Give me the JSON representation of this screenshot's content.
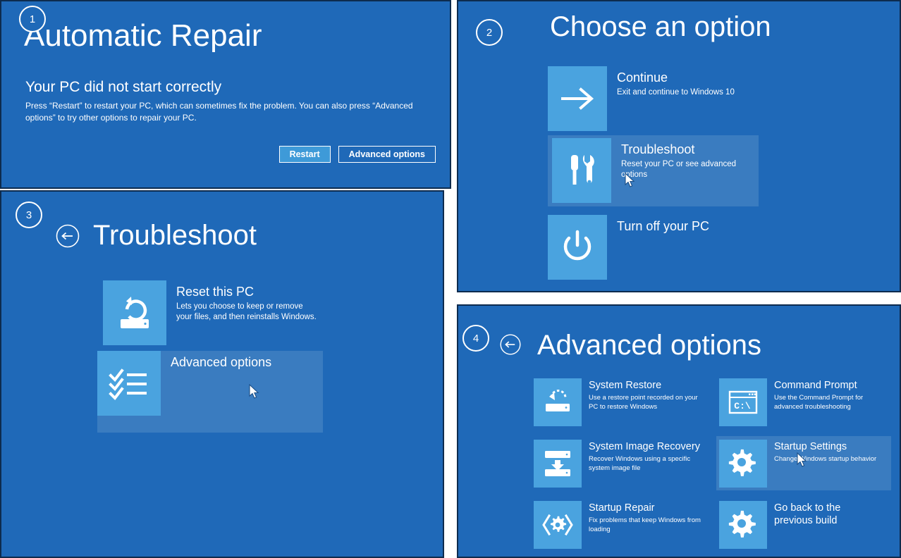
{
  "theme": {
    "background": "#1f69b8",
    "tile": "#4aa3df",
    "highlight": "#3a7cc0",
    "border": "#0d2b4e",
    "text": "#ffffff",
    "primary_button": "#3e9ad8"
  },
  "panels": [
    {
      "step": "1",
      "title": "Automatic Repair",
      "subtitle": "Your PC did not start correctly",
      "body": "Press “Restart” to restart your PC, which can sometimes fix the problem. You can also press “Advanced options” to try other options to repair your PC.",
      "buttons": [
        {
          "label": "Restart",
          "style": "primary"
        },
        {
          "label": "Advanced options",
          "style": "outline"
        }
      ]
    },
    {
      "step": "2",
      "title": "Choose an option",
      "back_arrow": false,
      "options": [
        {
          "title": "Continue",
          "desc": "Exit and continue to Windows 10",
          "icon": "arrow-right-icon",
          "highlighted": false
        },
        {
          "title": "Troubleshoot",
          "desc": "Reset your PC or see advanced options",
          "icon": "wrench-screwdriver-icon",
          "highlighted": true
        },
        {
          "title": "Turn off your PC",
          "desc": "",
          "icon": "power-icon",
          "highlighted": false
        }
      ]
    },
    {
      "step": "3",
      "title": "Troubleshoot",
      "back_arrow": true,
      "options": [
        {
          "title": "Reset this PC",
          "desc": "Lets you choose to keep or remove your files, and then reinstalls Windows.",
          "icon": "reset-pc-icon",
          "highlighted": false
        },
        {
          "title": "Advanced options",
          "desc": "",
          "icon": "checklist-icon",
          "highlighted": true
        }
      ]
    },
    {
      "step": "4",
      "title": "Advanced options",
      "back_arrow": true,
      "options": [
        {
          "title": "System Restore",
          "desc": "Use a restore point recorded on your PC to restore Windows",
          "icon": "system-restore-icon",
          "highlighted": false
        },
        {
          "title": "Command Prompt",
          "desc": "Use the Command Prompt for advanced troubleshooting",
          "icon": "command-prompt-icon",
          "highlighted": false
        },
        {
          "title": "System Image Recovery",
          "desc": "Recover Windows using a specific system image file",
          "icon": "system-image-recovery-icon",
          "highlighted": false
        },
        {
          "title": "Startup Settings",
          "desc": "Change Windows startup behavior",
          "icon": "gear-icon",
          "highlighted": true
        },
        {
          "title": "Startup Repair",
          "desc": "Fix problems that keep Windows from loading",
          "icon": "startup-repair-icon",
          "highlighted": false
        },
        {
          "title": "Go back to the previous build",
          "desc": "",
          "icon": "gear-icon",
          "highlighted": false
        }
      ]
    }
  ]
}
